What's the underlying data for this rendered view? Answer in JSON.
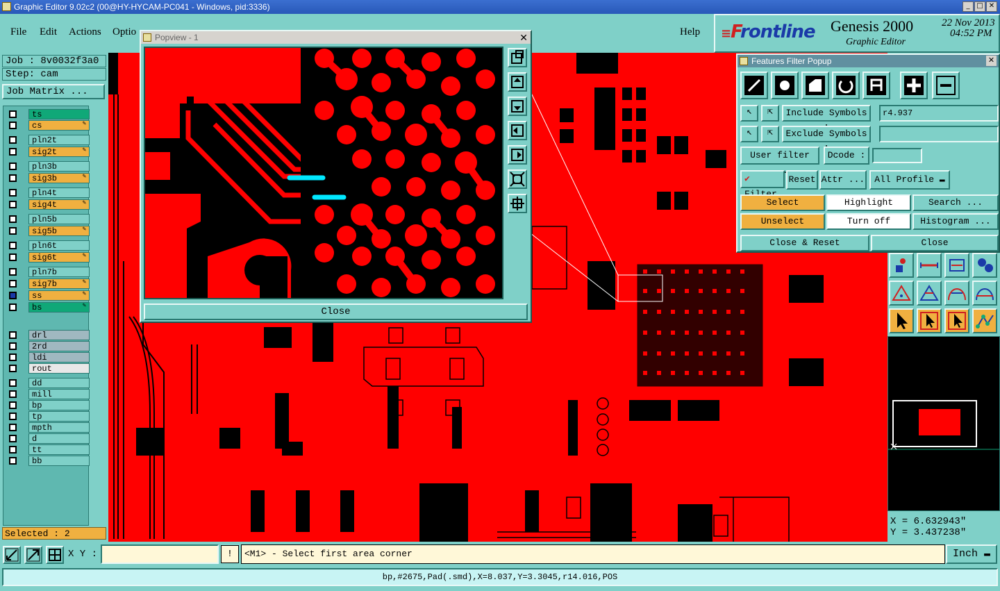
{
  "window": {
    "title": "Graphic Editor 9.02c2 (00@HY-HYCAM-PC041 - Windows, pid:3336)"
  },
  "menu": {
    "file": "File",
    "edit": "Edit",
    "actions": "Actions",
    "options": "Optio",
    "help": "Help"
  },
  "brand": {
    "logo_f": "F",
    "logo_rest": "rontline",
    "product": "Genesis 2000",
    "subtitle": "Graphic Editor",
    "date": "22 Nov 2013",
    "time": "04:52 PM"
  },
  "job": {
    "job": "Job : 8v0032f3a0",
    "step": "Step: cam",
    "matrix_button": "Job Matrix ..."
  },
  "layers": [
    {
      "name": "ts",
      "color": "#10a878",
      "mark": ""
    },
    {
      "name": "cs",
      "color": "#f0b040",
      "mark": "✎"
    },
    {
      "name": "pln2t",
      "color": "#7fd0c8",
      "mark": ""
    },
    {
      "name": "sig2t",
      "color": "#f0b040",
      "mark": "✎"
    },
    {
      "name": "pln3b",
      "color": "#7fd0c8",
      "mark": ""
    },
    {
      "name": "sig3b",
      "color": "#f0b040",
      "mark": "✎"
    },
    {
      "name": "pln4t",
      "color": "#7fd0c8",
      "mark": ""
    },
    {
      "name": "sig4t",
      "color": "#f0b040",
      "mark": "✎"
    },
    {
      "name": "pln5b",
      "color": "#7fd0c8",
      "mark": ""
    },
    {
      "name": "sig5b",
      "color": "#f0b040",
      "mark": "✎"
    },
    {
      "name": "pln6t",
      "color": "#7fd0c8",
      "mark": ""
    },
    {
      "name": "sig6t",
      "color": "#f0b040",
      "mark": "✎"
    },
    {
      "name": "pln7b",
      "color": "#7fd0c8",
      "mark": ""
    },
    {
      "name": "sig7b",
      "color": "#f0b040",
      "mark": "✎"
    },
    {
      "name": "ss",
      "color": "#f0b040",
      "mark": "✎"
    },
    {
      "name": "bs",
      "color": "#10a878",
      "mark": "✎"
    },
    {
      "name": "drl",
      "color": "#a0b8c0",
      "mark": ""
    },
    {
      "name": "2rd",
      "color": "#a0b8c0",
      "mark": ""
    },
    {
      "name": "ldi",
      "color": "#a0b8c0",
      "mark": ""
    },
    {
      "name": "rout",
      "color": "#e8e8e8",
      "mark": ""
    },
    {
      "name": "dd",
      "color": "#7fd0c8",
      "mark": ""
    },
    {
      "name": "mill",
      "color": "#7fd0c8",
      "mark": ""
    },
    {
      "name": "bp",
      "color": "#7fd0c8",
      "mark": ""
    },
    {
      "name": "tp",
      "color": "#7fd0c8",
      "mark": ""
    },
    {
      "name": "mpth",
      "color": "#7fd0c8",
      "mark": ""
    },
    {
      "name": "d",
      "color": "#7fd0c8",
      "mark": ""
    },
    {
      "name": "tt",
      "color": "#7fd0c8",
      "mark": ""
    },
    {
      "name": "bb",
      "color": "#7fd0c8",
      "mark": ""
    }
  ],
  "selected": "Selected : 2",
  "popview": {
    "title": "Popview - 1",
    "close": "Close"
  },
  "filter": {
    "title": "Features Filter Popup",
    "include_label": "Include Symbols :",
    "include_value": "r4.937",
    "exclude_label": "Exclude Symbols :",
    "exclude_value": "",
    "user_filter": "User filter ...",
    "dcode": "Dcode :",
    "dcode_value": "",
    "filter": "Filter",
    "reset": "Reset",
    "attr": "Attr ...",
    "profile": "All Profile",
    "select": "Select",
    "highlight": "Highlight",
    "search": "Search ...",
    "unselect": "Unselect",
    "turn_off": "Turn off",
    "histogram": "Histogram ...",
    "close_reset": "Close & Reset",
    "close": "Close"
  },
  "coords": {
    "x": "X =  6.632943\"",
    "y": "Y =  3.437238\""
  },
  "bottom": {
    "xy_label": "X Y :",
    "xy_value": "",
    "excl": "!",
    "prompt": "<M1> - Select first area corner",
    "units": "Inch"
  },
  "status": "bp,#2675,Pad(.smd),X=8.037,Y=3.3045,r14.016,POS"
}
